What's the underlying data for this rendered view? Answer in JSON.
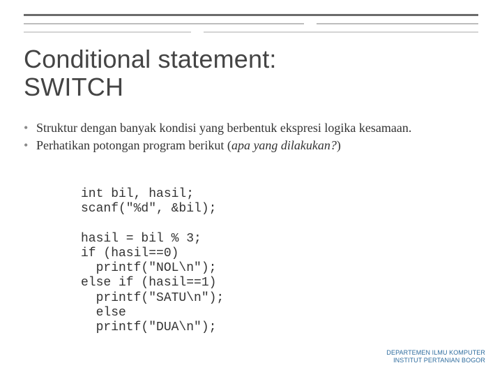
{
  "title": "Conditional statement: SWITCH",
  "bullets": [
    {
      "pre": "Struktur dengan banyak kondisi yang berbentuk ekspresi logika kesamaan."
    },
    {
      "pre": "Perhatikan potongan program berikut (",
      "em": "apa yang dilakuka​n?",
      "post": ")"
    }
  ],
  "code": "int bil, hasil;\nscanf(\"%d\", &bil);\n\nhasil = bil % 3;\nif (hasil==0)\n  printf(\"NOL\\n\");\nelse if (hasil==1)\n  printf(\"SATU\\n\");\n  else\n  printf(\"DUA\\n\");",
  "footer": {
    "line1": "DEPARTEMEN ILMU KOMPUTER",
    "line2": "INSTITUT PERTANIAN BOGOR"
  }
}
